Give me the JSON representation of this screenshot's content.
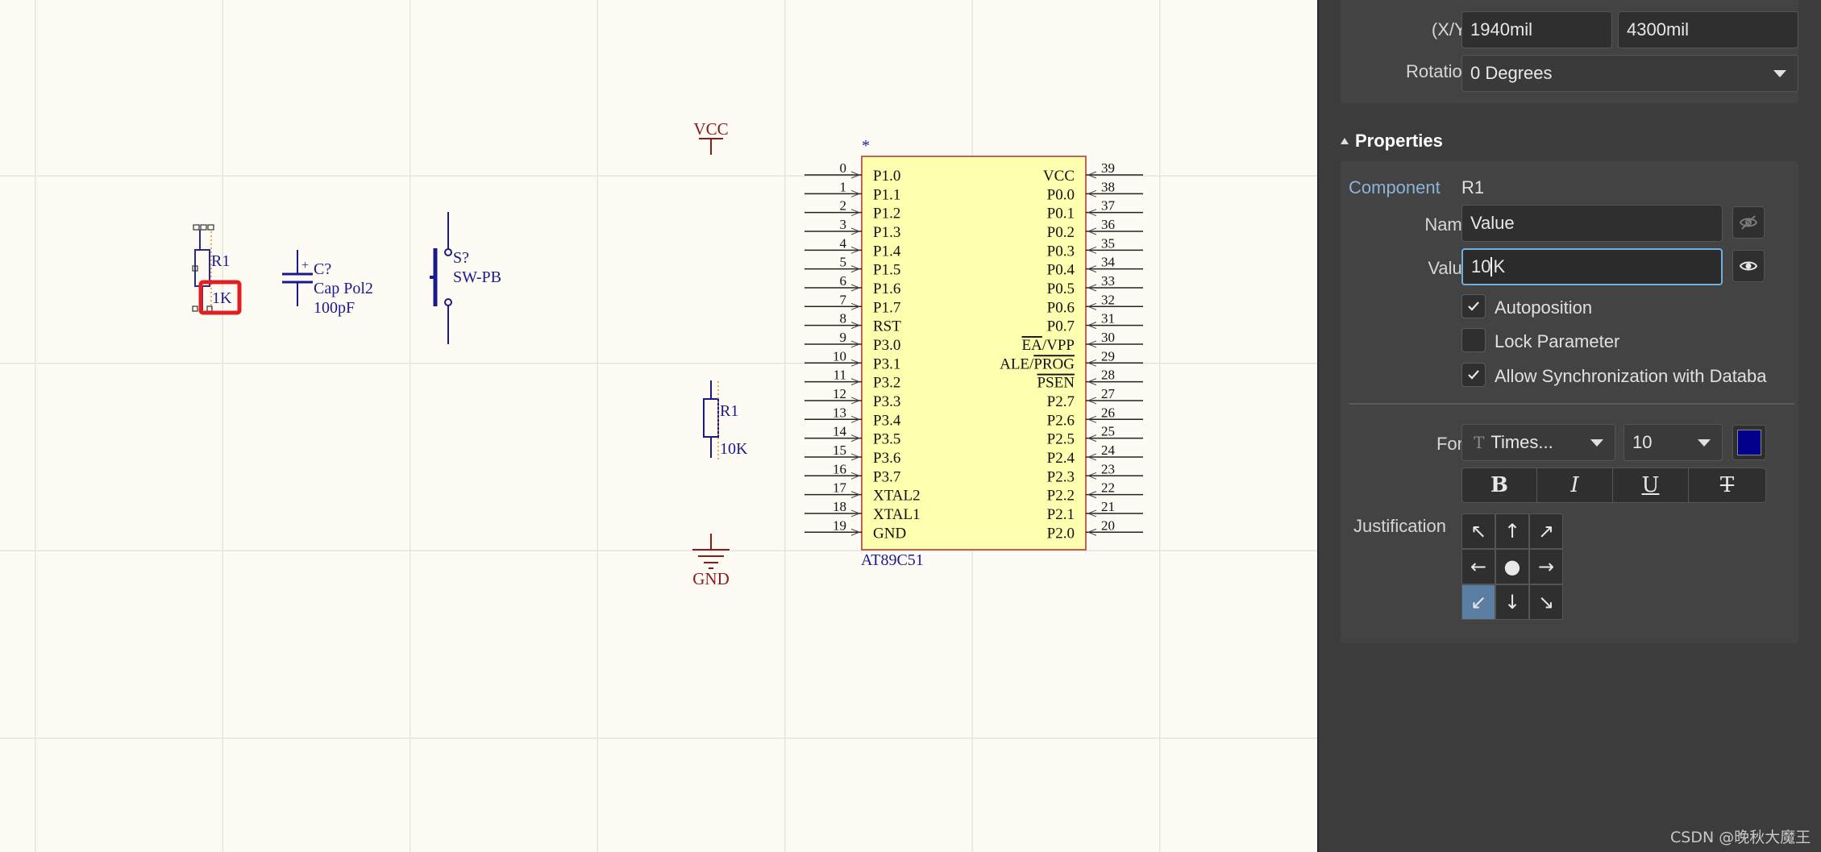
{
  "schematic": {
    "r_small": {
      "designator": "R1",
      "value": "1K"
    },
    "capacitor": {
      "designator": "C?",
      "comment": "Cap Pol2",
      "value": "100pF",
      "plus": "+"
    },
    "switch": {
      "designator": "S?",
      "comment": "SW-PB"
    },
    "vcc_port": "VCC",
    "gnd_port": "GND",
    "r_main": {
      "designator": "R1",
      "value": "10K"
    },
    "mcu": {
      "name": "AT89C51",
      "marker": "*",
      "left_pins": [
        {
          "num": "0",
          "name": "P1.0"
        },
        {
          "num": "1",
          "name": "P1.1"
        },
        {
          "num": "2",
          "name": "P1.2"
        },
        {
          "num": "3",
          "name": "P1.3"
        },
        {
          "num": "4",
          "name": "P1.4"
        },
        {
          "num": "5",
          "name": "P1.5"
        },
        {
          "num": "6",
          "name": "P1.6"
        },
        {
          "num": "7",
          "name": "P1.7"
        },
        {
          "num": "8",
          "name": "RST"
        },
        {
          "num": "9",
          "name": "P3.0"
        },
        {
          "num": "10",
          "name": "P3.1"
        },
        {
          "num": "11",
          "name": "P3.2"
        },
        {
          "num": "12",
          "name": "P3.3"
        },
        {
          "num": "13",
          "name": "P3.4"
        },
        {
          "num": "14",
          "name": "P3.5"
        },
        {
          "num": "15",
          "name": "P3.6"
        },
        {
          "num": "16",
          "name": "P3.7"
        },
        {
          "num": "17",
          "name": "XTAL2"
        },
        {
          "num": "18",
          "name": "XTAL1"
        },
        {
          "num": "19",
          "name": "GND"
        }
      ],
      "right_pins": [
        {
          "num": "39",
          "name": "VCC"
        },
        {
          "num": "38",
          "name": "P0.0"
        },
        {
          "num": "37",
          "name": "P0.1"
        },
        {
          "num": "36",
          "name": "P0.2"
        },
        {
          "num": "35",
          "name": "P0.3"
        },
        {
          "num": "34",
          "name": "P0.4"
        },
        {
          "num": "33",
          "name": "P0.5"
        },
        {
          "num": "32",
          "name": "P0.6"
        },
        {
          "num": "31",
          "name": "P0.7"
        },
        {
          "num": "30",
          "name": "EA/VPP",
          "overbar": "EA",
          "rest": "/VPP"
        },
        {
          "num": "29",
          "name": "ALE/PROG",
          "prefix": "ALE/",
          "overbar": "PROG"
        },
        {
          "num": "28",
          "name": "PSEN",
          "overbar": "PSEN"
        },
        {
          "num": "27",
          "name": "P2.7"
        },
        {
          "num": "26",
          "name": "P2.6"
        },
        {
          "num": "25",
          "name": "P2.5"
        },
        {
          "num": "24",
          "name": "P2.4"
        },
        {
          "num": "23",
          "name": "P2.3"
        },
        {
          "num": "22",
          "name": "P2.2"
        },
        {
          "num": "21",
          "name": "P2.1"
        },
        {
          "num": "20",
          "name": "P2.0"
        }
      ]
    }
  },
  "panel": {
    "location": {
      "xy_label": "(X/Y)",
      "x_value": "1940mil",
      "y_value": "4300mil",
      "rotation_label": "Rotation",
      "rotation_value": "0 Degrees"
    },
    "properties": {
      "title": "Properties",
      "component_label": "Component",
      "component_value": "R1",
      "name_label": "Name",
      "name_value": "Value",
      "value_label": "Value",
      "value_before_caret": "10",
      "value_after_caret": "K",
      "autoposition": "Autoposition",
      "lock_parameter": "Lock Parameter",
      "allow_sync": "Allow Synchronization with Databa",
      "font_label": "Font",
      "font_name": "Times...",
      "font_size": "10",
      "font_color": "#00008b",
      "justification_label": "Justification",
      "justification_arrows": [
        "↖",
        "↑",
        "↗",
        "←",
        "●",
        "→",
        "↙",
        "↓",
        "↘"
      ],
      "format_buttons": [
        "B",
        "I",
        "U",
        "T"
      ]
    }
  },
  "watermark": "CSDN @晚秋大魔王"
}
